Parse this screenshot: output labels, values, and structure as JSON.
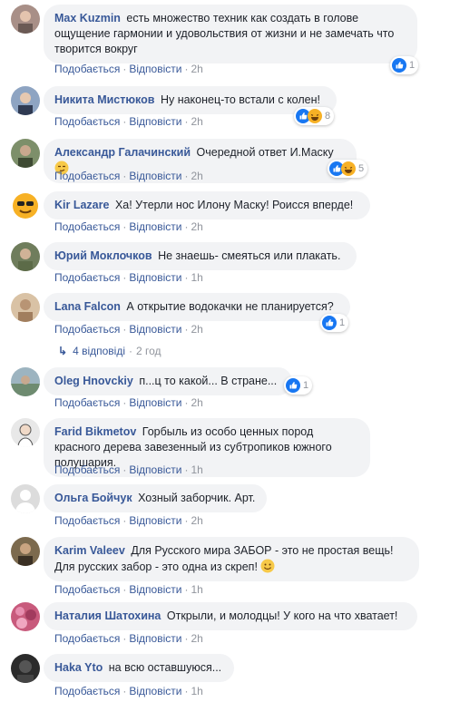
{
  "actions": {
    "like": "Подобається",
    "reply": "Відповісти",
    "sep": "·"
  },
  "comments": [
    {
      "author": "Max Kuzmin",
      "text": "есть множество техник как создать в голове ощущение гармонии и удовольствия от жизни и не замечать что творится вокруг",
      "time": "2h",
      "reactions": "1"
    },
    {
      "author": "Никита Мистюков",
      "text": "Ну наконец-то встали с колен!",
      "time": "2h",
      "reactions": "8"
    },
    {
      "author": "Александр Галачинский",
      "text": "Очередной ответ И.Маску",
      "time": "2h",
      "reactions": "5"
    },
    {
      "author": "Kir Lazare",
      "text": "Ха! Утерли нос Илону Маску! Роисся вперде!",
      "time": "2h"
    },
    {
      "author": "Юрий Моклочков",
      "text": "Не знаешь- смеяться или плакать.",
      "time": "1h"
    },
    {
      "author": "Lana Falcon",
      "text": "А открытие водокачки не планируется?",
      "time": "2h",
      "reactions": "1"
    },
    {
      "author": "Oleg Hnovckiy",
      "text": "п...ц то какой... В стране...",
      "time": "2h",
      "reactions": "1"
    },
    {
      "author": "Farid Bikmetov",
      "text": "Горбыль из особо ценных пород красного дерева завезенный из субтропиков южного полушария.",
      "time": "1h"
    },
    {
      "author": "Ольга Бойчук",
      "text": "Хозный заборчик. Арт.",
      "time": "2h"
    },
    {
      "author": "Karim Valeev",
      "text": "Для Русского мира ЗАБОР - это не простая вещь! Для русских забор - это одна из скреп!",
      "time": "1h"
    },
    {
      "author": "Наталия Шатохина",
      "text": "Открыли, и молодцы! У кого на что хватает!",
      "time": "2h"
    },
    {
      "author": "Haka Yto",
      "text": "на всю оставшуюся...",
      "time": "1h"
    }
  ],
  "replies": {
    "label": "4 відповіді",
    "time": "2 год"
  },
  "colors": {
    "link": "#385898",
    "bubble": "#f2f3f5",
    "like_blue": "#1877f2",
    "haha_yellow": "#f7b125"
  },
  "icons": [
    "like-reaction-icon",
    "haha-reaction-icon",
    "smiley-emoji-icon",
    "reply-arrow-icon"
  ]
}
